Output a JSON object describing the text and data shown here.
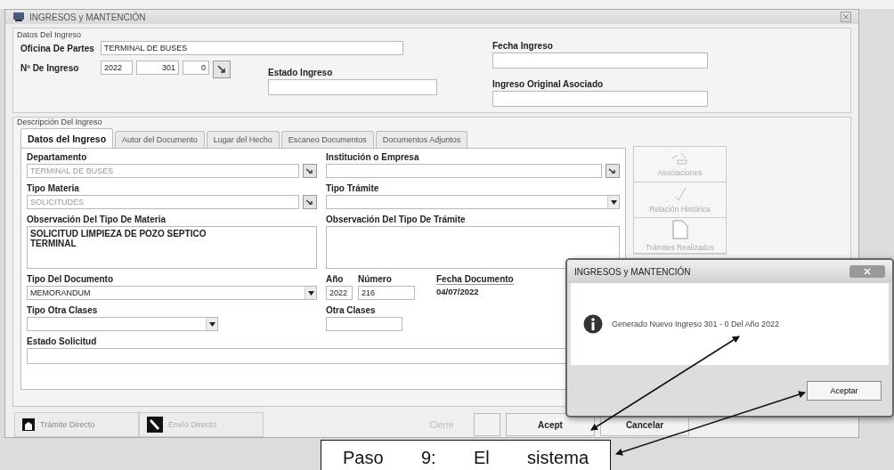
{
  "window": {
    "title": "INGRESOS y MANTENCIÓN"
  },
  "datos_ingreso": {
    "legend": "Datos Del Ingreso",
    "oficina": {
      "label": "Oficina De Partes",
      "value": "TERMINAL DE BUSES"
    },
    "fecha_ingreso": {
      "label": "Fecha Ingreso"
    },
    "numero": {
      "label": "Nº De Ingreso",
      "values": [
        "2022",
        "301",
        "0"
      ]
    },
    "estado_ingreso": {
      "label": "Estado Ingreso"
    },
    "ingreso_original": {
      "label": "Ingreso Original Asociado"
    }
  },
  "descripcion": {
    "legend": "Descripción Del Ingreso",
    "tabs": [
      {
        "label": "Datos del Ingreso",
        "selected": true
      },
      {
        "label": "Autor del Documento",
        "selected": false
      },
      {
        "label": "Lugar del Hecho",
        "selected": false
      },
      {
        "label": "Escaneo Documentos",
        "selected": false
      },
      {
        "label": "Documentos Adjuntos",
        "selected": false
      }
    ],
    "departamento": {
      "label": "Departamento",
      "value": "TERMINAL DE BUSES",
      "disabled": true
    },
    "institucion": {
      "label": "Institución o Empresa"
    },
    "tipo_materia": {
      "label": "Tipo Materia",
      "value": "SOLICITUDES",
      "disabled": true
    },
    "tipo_tramite": {
      "label": "Tipo Trámite"
    },
    "obs_materia": {
      "label": "Observación Del Tipo De Materia",
      "value": "SOLICITUD LIMPIEZA DE POZO SEPTICO\nTERMINAL"
    },
    "obs_tramite": {
      "label": "Observación Del Tipo De Trámite"
    },
    "tipo_documento": {
      "label": "Tipo Del Documento",
      "value": "MEMORANDUM"
    },
    "anio": {
      "label": "Año",
      "value": "2022"
    },
    "numero": {
      "label": "Número",
      "value": "216"
    },
    "fecha_documento": {
      "label": "Fecha Documento",
      "value": "04/07/2022"
    },
    "tipo_otra": {
      "label": "Tipo Otra Clases"
    },
    "otra_clases": {
      "label": "Otra Clases"
    },
    "estado_solicitud": {
      "label": "Estado Solicitud"
    },
    "side_buttons": [
      {
        "label": "Asociaciones",
        "kind": "link",
        "disabled": true
      },
      {
        "label": "Relación Histórica",
        "kind": "check",
        "disabled": true
      },
      {
        "label": "Trámites Realizados",
        "kind": "doc",
        "disabled": true
      }
    ]
  },
  "bottom_buttons": [
    {
      "label": "Trámite Directo",
      "kind": "tramite",
      "disabled": false
    },
    {
      "label": "Envío Directo",
      "kind": "envio",
      "disabled": true
    }
  ],
  "actions": [
    {
      "label": "Cierre",
      "disabled": true
    },
    {
      "disabled": false
    },
    {
      "label": "Acept",
      "disabled": false
    },
    {
      "label": "Cancelar",
      "disabled": false
    }
  ],
  "dialog": {
    "title": "INGRESOS y MANTENCIÓN",
    "message": "Generado Nuevo Ingreso 301 - 0 Del Año 2022",
    "button": "Aceptar"
  },
  "callout": {
    "text": "Paso 9: El sistema"
  }
}
